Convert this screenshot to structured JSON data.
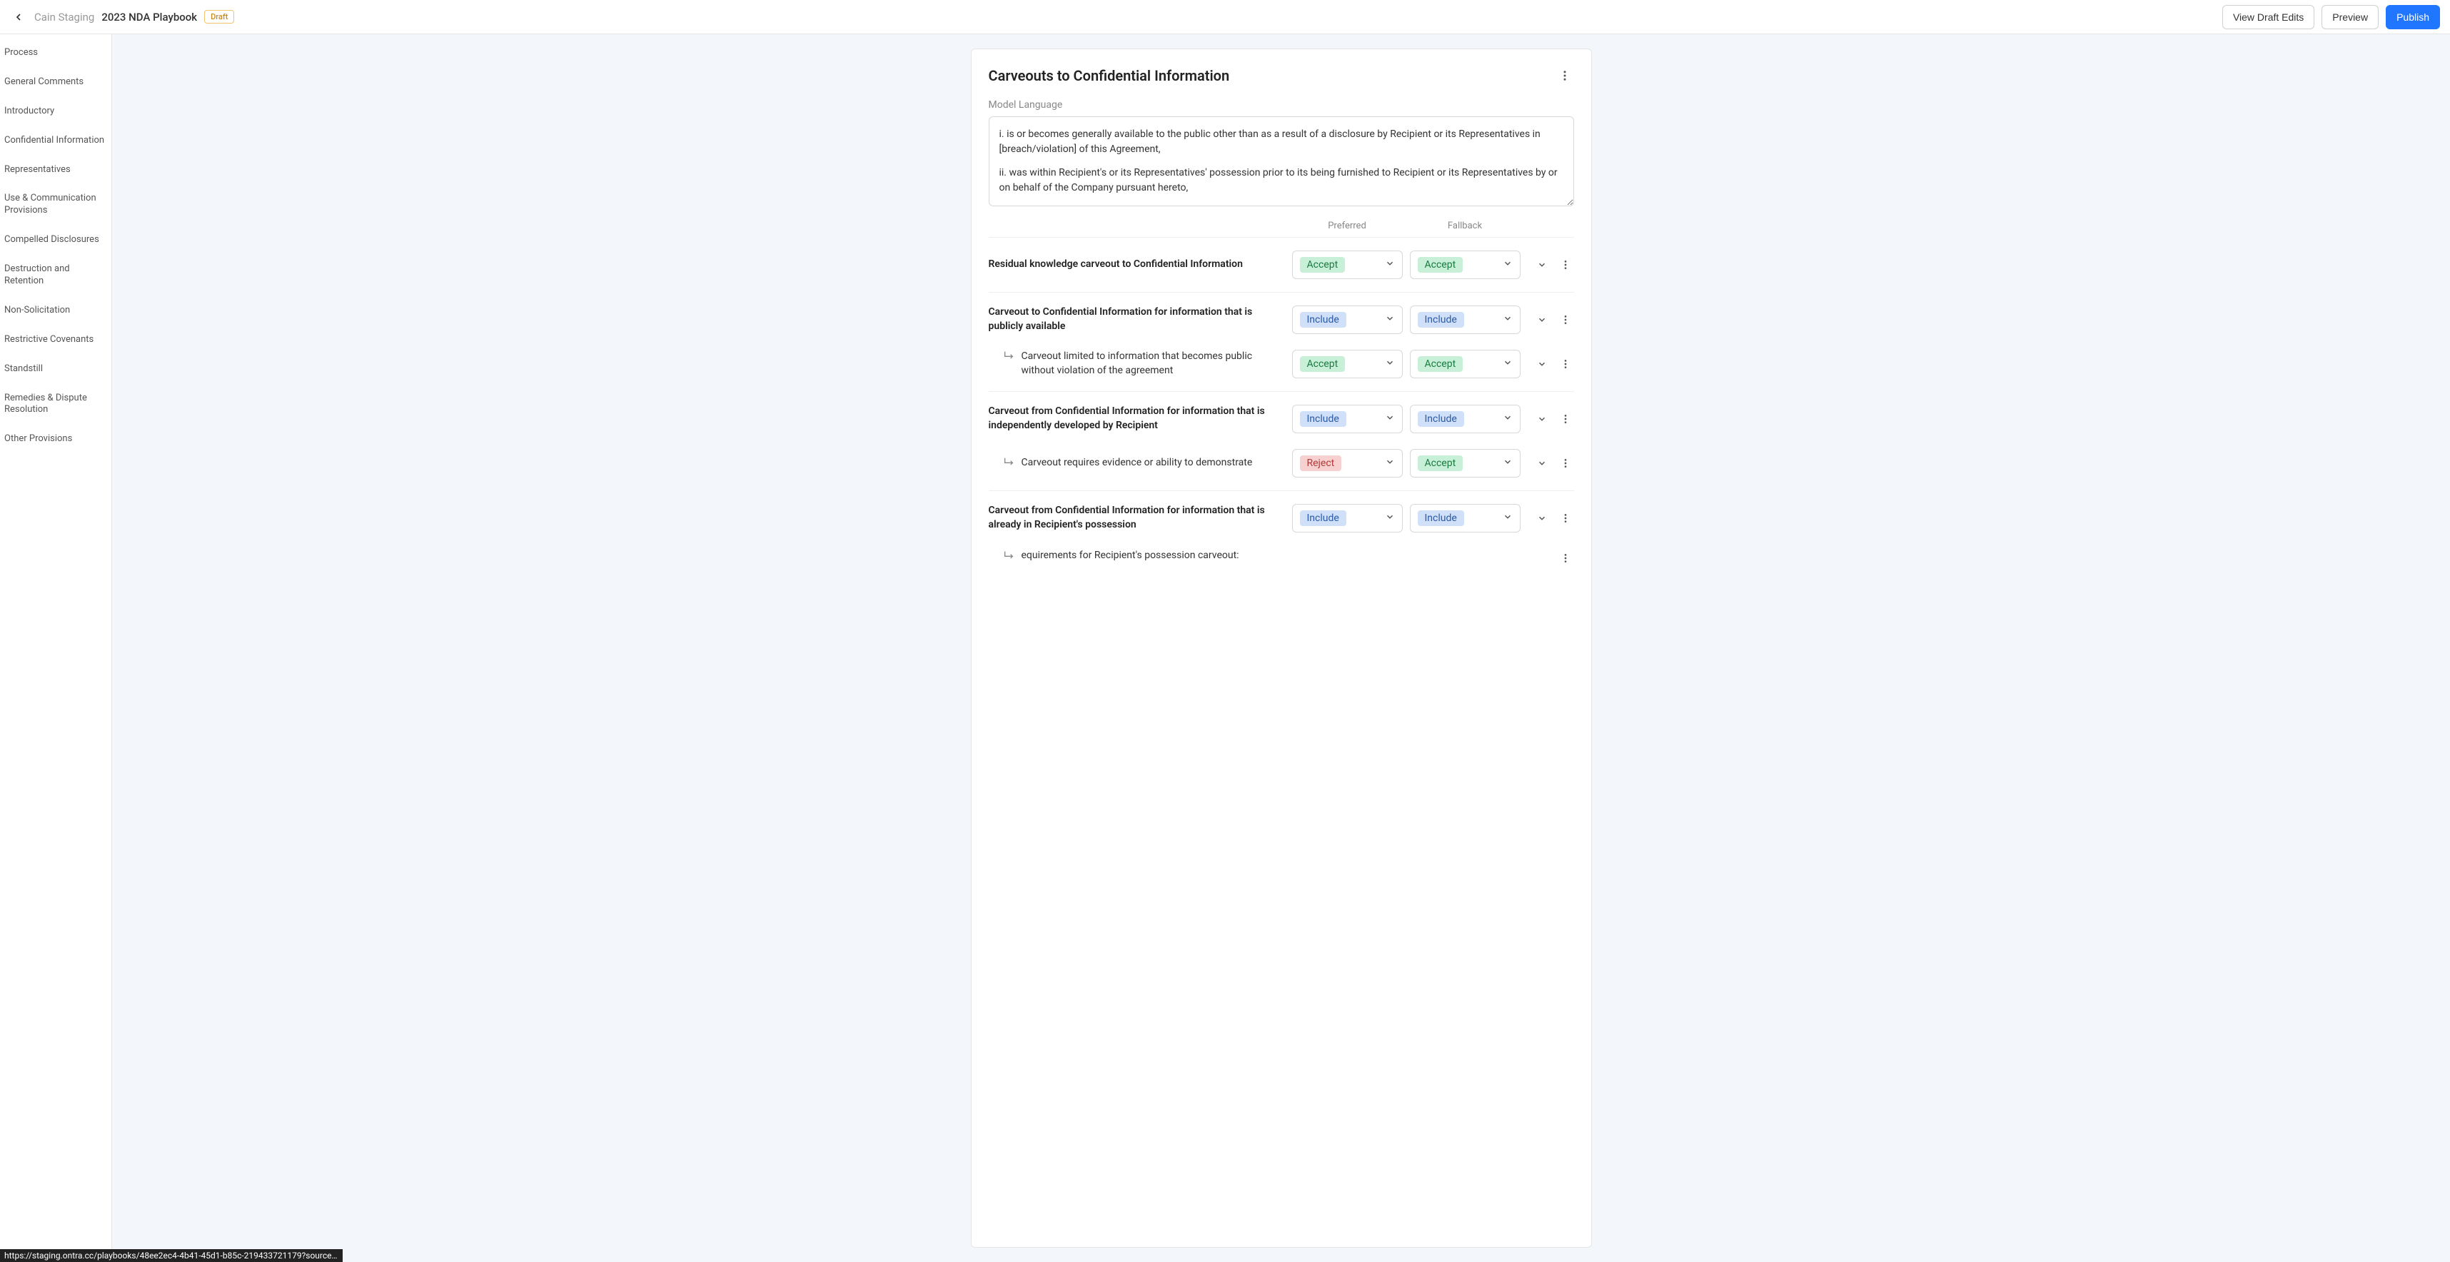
{
  "header": {
    "org": "Cain Staging",
    "title": "2023 NDA Playbook",
    "badge": "Draft",
    "actions": {
      "view_draft_edits": "View Draft Edits",
      "preview": "Preview",
      "publish": "Publish"
    }
  },
  "sidebar": {
    "items": [
      "Process",
      "General Comments",
      "Introductory",
      "Confidential Information",
      "Representatives",
      "Use & Communication Provisions",
      "Compelled Disclosures",
      "Destruction and Retention",
      "Non-Solicitation",
      "Restrictive Covenants",
      "Standstill",
      "Remedies & Dispute Resolution",
      "Other Provisions"
    ]
  },
  "card": {
    "title": "Carveouts to Confidential Information",
    "model_language_label": "Model Language",
    "model_language_1": "i. is or becomes generally available to the public other than as a result of a disclosure by Recipient or its Representatives in [breach/violation] of this Agreement,",
    "model_language_2": "ii. was within Recipient's or its Representatives' possession prior to its being furnished to Recipient or its Representatives by or on behalf of the Company pursuant hereto,",
    "columns": {
      "preferred": "Preferred",
      "fallback": "Fallback"
    }
  },
  "rows": [
    {
      "text": "Residual knowledge carveout to Confidential Information",
      "preferred": "Accept",
      "preferred_type": "accept",
      "fallback": "Accept",
      "fallback_type": "accept",
      "sub": false
    },
    {
      "text": "Carveout to Confidential Information for information that is publicly available",
      "preferred": "Include",
      "preferred_type": "include",
      "fallback": "Include",
      "fallback_type": "include",
      "sub": false
    },
    {
      "text": "Carveout limited to information that becomes public without violation of the agreement",
      "preferred": "Accept",
      "preferred_type": "accept",
      "fallback": "Accept",
      "fallback_type": "accept",
      "sub": true
    },
    {
      "text": "Carveout from Confidential Information for information that is independently developed by Recipient",
      "preferred": "Include",
      "preferred_type": "include",
      "fallback": "Include",
      "fallback_type": "include",
      "sub": false
    },
    {
      "text": "Carveout requires evidence or ability to demonstrate",
      "preferred": "Reject",
      "preferred_type": "reject",
      "fallback": "Accept",
      "fallback_type": "accept",
      "sub": true
    },
    {
      "text": "Carveout from Confidential Information for information that is already in Recipient's possession",
      "preferred": "Include",
      "preferred_type": "include",
      "fallback": "Include",
      "fallback_type": "include",
      "sub": false
    }
  ],
  "partial_row": {
    "text": "equirements for Recipient's possession carveout:"
  },
  "status_bar": "https://staging.ontra.cc/playbooks/48ee2ec4-4b41-45d1-b85c-219433721179?source=admin.ac…"
}
